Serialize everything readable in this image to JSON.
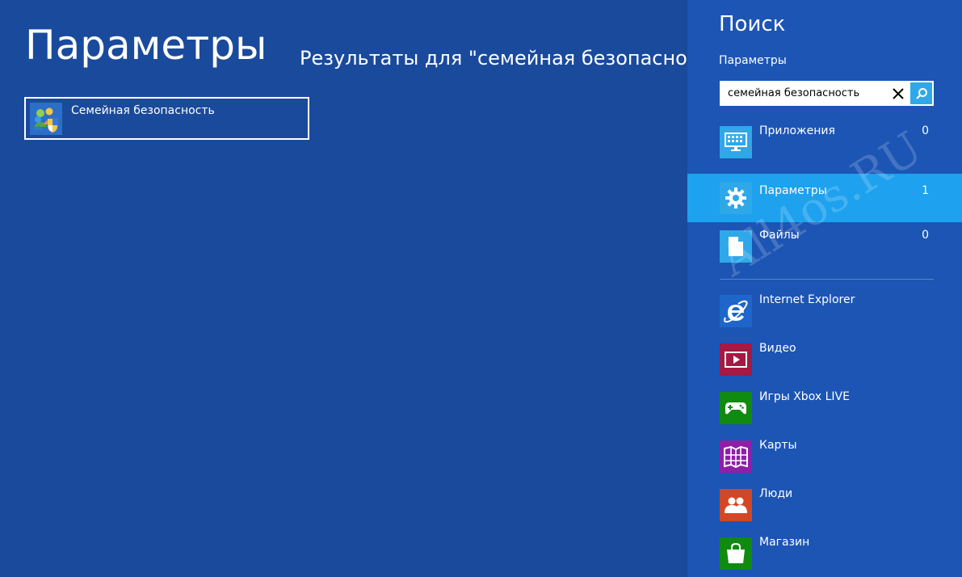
{
  "main": {
    "title": "Параметры",
    "results_heading": "Результаты для \"семейная безопасность",
    "results": [
      {
        "label": "Семейная безопасность",
        "icon": "family-safety-icon"
      }
    ]
  },
  "charm": {
    "title": "Поиск",
    "scope": "Параметры",
    "search": {
      "value": "семейная безопасность",
      "placeholder": ""
    },
    "categories": [
      {
        "label": "Приложения",
        "count": "0",
        "icon": "apps-icon",
        "color": "#2ea8e8"
      },
      {
        "label": "Параметры",
        "count": "1",
        "icon": "gear-icon",
        "color": "#2ea8e8",
        "selected": true
      },
      {
        "label": "Файлы",
        "count": "0",
        "icon": "file-icon",
        "color": "#2ea8e8"
      }
    ],
    "apps": [
      {
        "label": "Internet Explorer",
        "icon": "internet-explorer-icon",
        "color": "#1e66c9"
      },
      {
        "label": "Видео",
        "icon": "video-icon",
        "color": "#a51942"
      },
      {
        "label": "Игры Xbox LIVE",
        "icon": "xbox-games-icon",
        "color": "#118a11"
      },
      {
        "label": "Карты",
        "icon": "maps-icon",
        "color": "#8e1fa8"
      },
      {
        "label": "Люди",
        "icon": "people-icon",
        "color": "#d24726"
      },
      {
        "label": "Магазин",
        "icon": "store-icon",
        "color": "#118a11"
      }
    ]
  },
  "watermark": "All4os.RU",
  "colors": {
    "background": "#1a4a9c",
    "charm_background": "#1c55b4",
    "selected": "#1ea1ee",
    "search_button": "#2ea8e8"
  }
}
